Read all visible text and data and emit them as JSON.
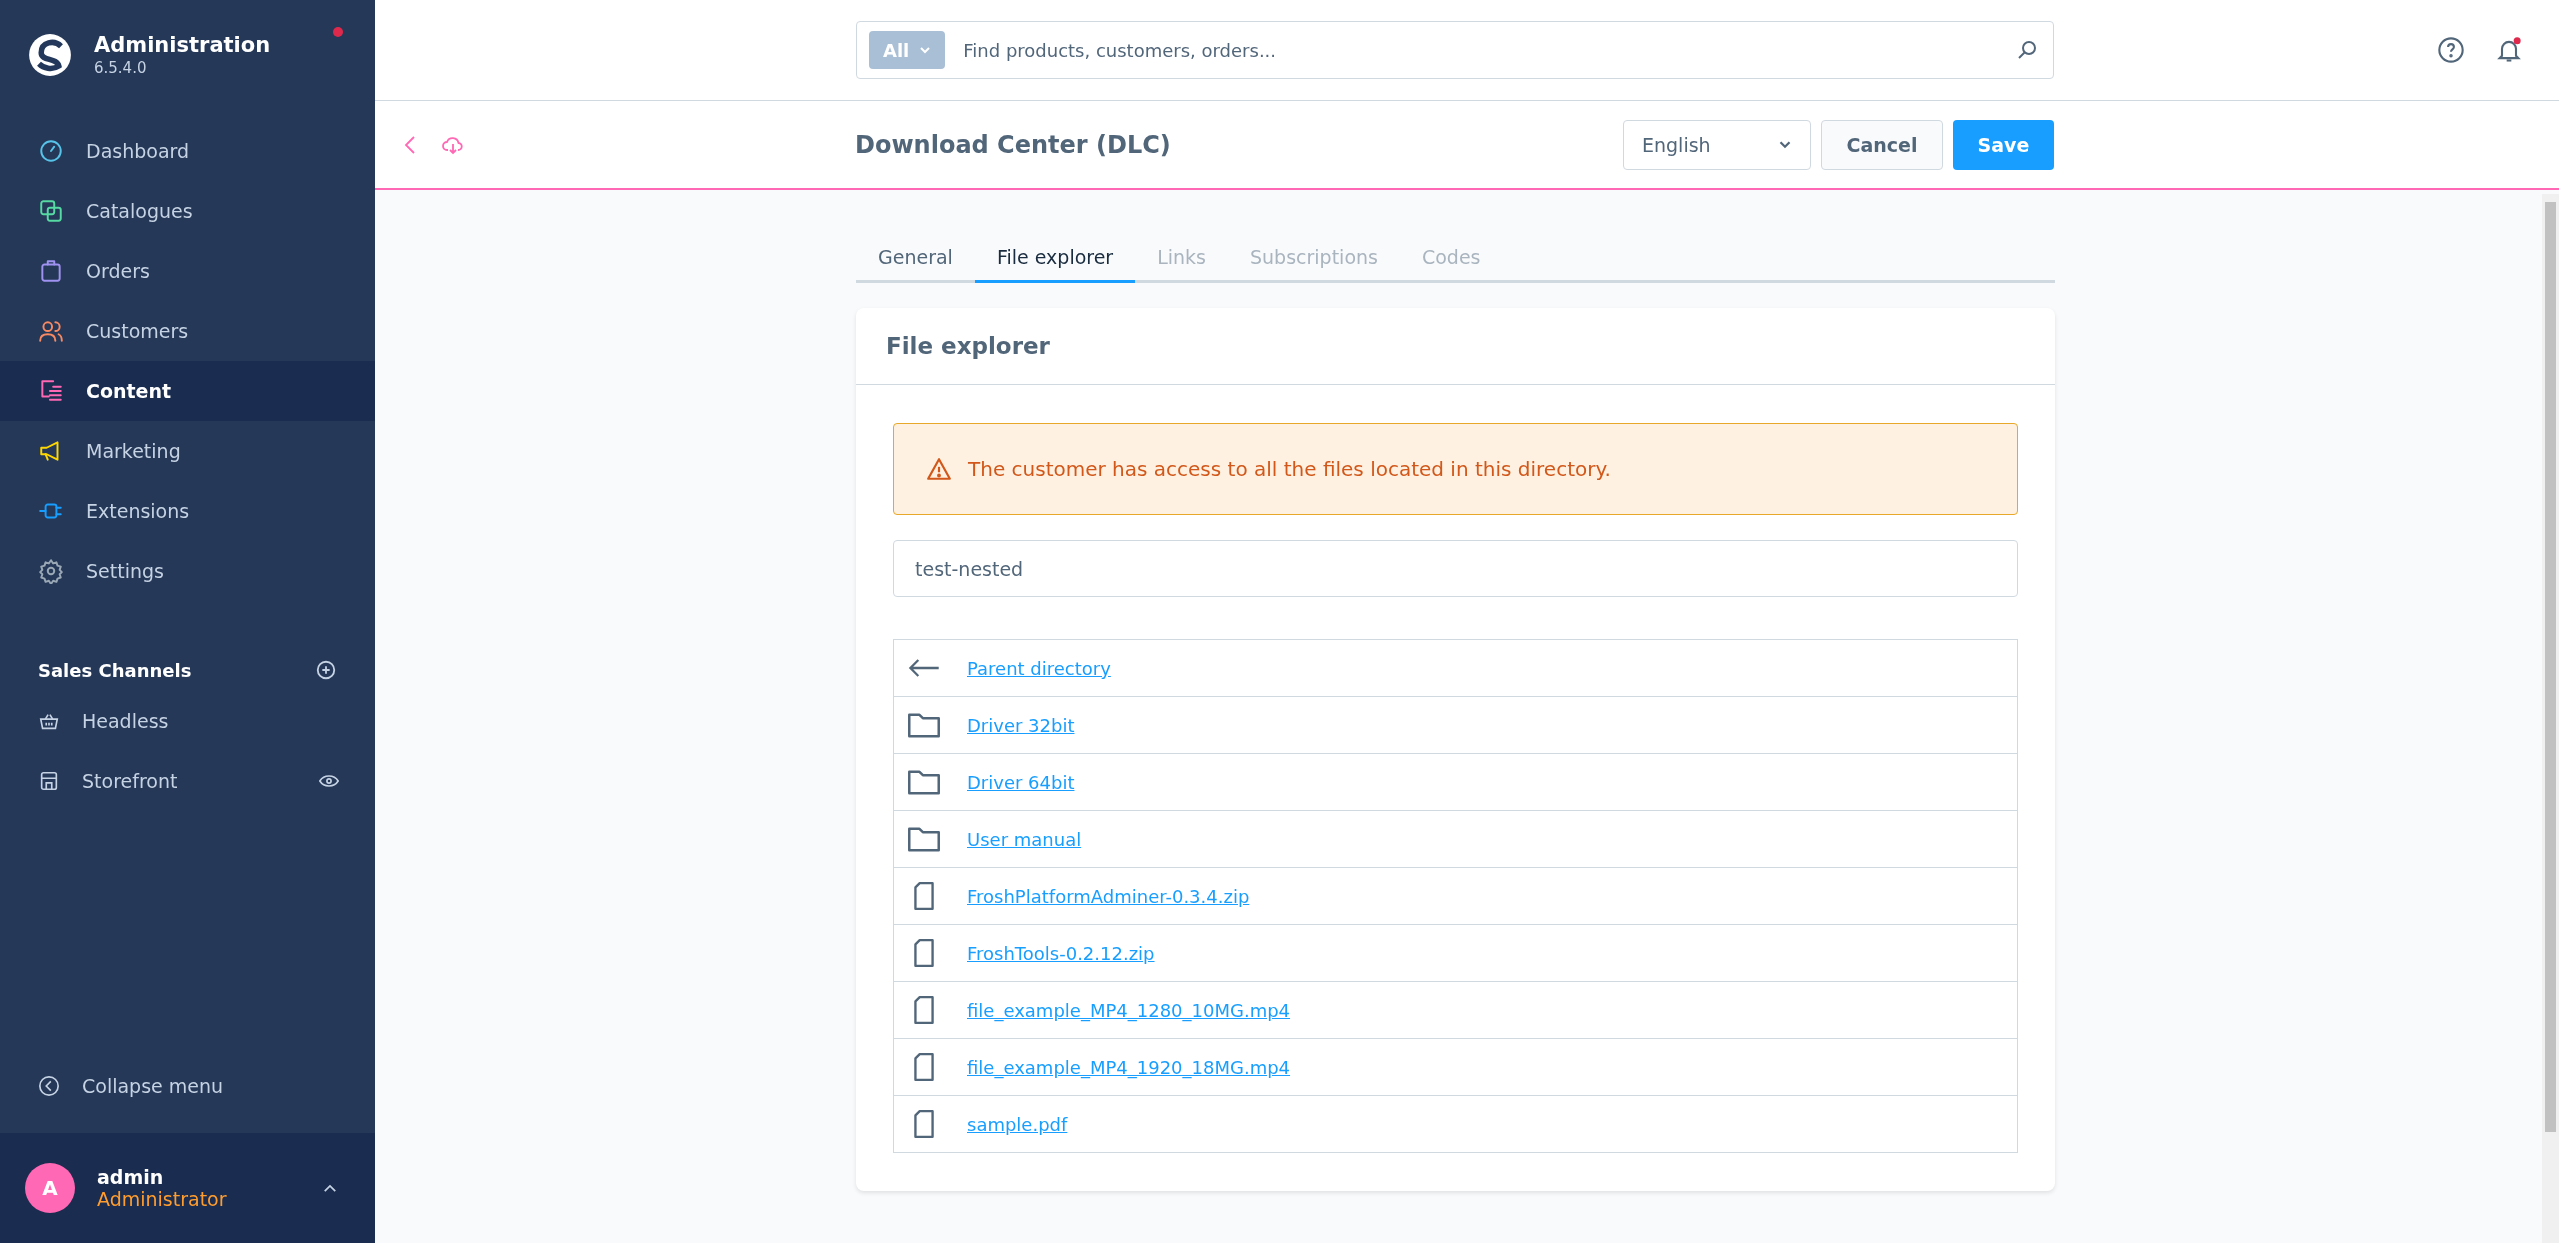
{
  "brand": {
    "title": "Administration",
    "version": "6.5.4.0"
  },
  "nav": [
    {
      "label": "Dashboard",
      "kind": "dashboard",
      "color": "#57c3e8",
      "selected": false
    },
    {
      "label": "Catalogues",
      "kind": "catalogues",
      "color": "#57d9a3",
      "selected": false
    },
    {
      "label": "Orders",
      "kind": "orders",
      "color": "#a092f0",
      "selected": false
    },
    {
      "label": "Customers",
      "kind": "customers",
      "color": "#f88962",
      "selected": false
    },
    {
      "label": "Content",
      "kind": "content",
      "color": "#ff68b4",
      "selected": true
    },
    {
      "label": "Marketing",
      "kind": "marketing",
      "color": "#ffd700",
      "selected": false
    },
    {
      "label": "Extensions",
      "kind": "extensions",
      "color": "#189eff",
      "selected": false
    },
    {
      "label": "Settings",
      "kind": "settings",
      "color": "#9aa8b5",
      "selected": false
    }
  ],
  "sales_channels": {
    "title": "Sales Channels",
    "items": [
      {
        "label": "Headless",
        "kind": "basket",
        "preview": false
      },
      {
        "label": "Storefront",
        "kind": "store",
        "preview": true
      }
    ]
  },
  "collapse": "Collapse menu",
  "user": {
    "initial": "A",
    "name": "admin",
    "role": "Administrator"
  },
  "search": {
    "scope": "All",
    "placeholder": "Find products, customers, orders..."
  },
  "header": {
    "title": "Download Center (DLC)",
    "language": "English",
    "cancel": "Cancel",
    "save": "Save"
  },
  "tabs": [
    {
      "label": "General",
      "selected": false,
      "disabled": false
    },
    {
      "label": "File explorer",
      "selected": true,
      "disabled": false
    },
    {
      "label": "Links",
      "selected": false,
      "disabled": true
    },
    {
      "label": "Subscriptions",
      "selected": false,
      "disabled": true
    },
    {
      "label": "Codes",
      "selected": false,
      "disabled": true
    }
  ],
  "card": {
    "title": "File explorer",
    "warning": "The customer has access to all the files located in this directory.",
    "path": "test-nested",
    "entries": [
      {
        "kind": "parent",
        "name": "Parent directory"
      },
      {
        "kind": "folder",
        "name": "Driver 32bit"
      },
      {
        "kind": "folder",
        "name": "Driver 64bit"
      },
      {
        "kind": "folder",
        "name": "User manual"
      },
      {
        "kind": "file",
        "name": "FroshPlatformAdminer-0.3.4.zip"
      },
      {
        "kind": "file",
        "name": "FroshTools-0.2.12.zip"
      },
      {
        "kind": "file",
        "name": "file_example_MP4_1280_10MG.mp4"
      },
      {
        "kind": "file",
        "name": "file_example_MP4_1920_18MG.mp4"
      },
      {
        "kind": "file",
        "name": "sample.pdf"
      }
    ]
  }
}
